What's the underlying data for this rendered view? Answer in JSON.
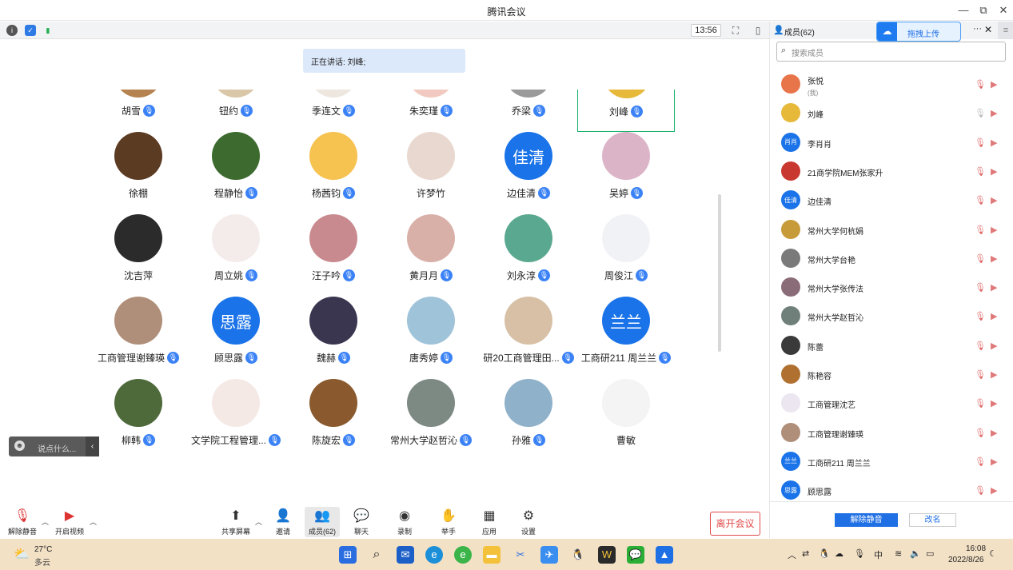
{
  "window": {
    "title": "腾讯会议",
    "minimize": "—",
    "restore": "⧉",
    "close": "✕"
  },
  "top": {
    "clock": "13:56",
    "info_icon": "info-icon",
    "shield_icon": "shield-icon",
    "signal_icon": "signal-icon"
  },
  "speaking": "正在讲话: 刘峰;",
  "participants": [
    {
      "name": "胡雪",
      "mic": true,
      "color": "#b5834f",
      "initials": ""
    },
    {
      "name": "钮约",
      "mic": true,
      "color": "#d9c7a8",
      "initials": ""
    },
    {
      "name": "季连文",
      "mic": true,
      "color": "#ede7df",
      "initials": ""
    },
    {
      "name": "朱奕瑾",
      "mic": true,
      "color": "#f1c9c0",
      "initials": ""
    },
    {
      "name": "乔梁",
      "mic": true,
      "color": "#9a9a9a",
      "initials": ""
    },
    {
      "name": "刘峰",
      "mic": true,
      "color": "#e6b93a",
      "initials": "",
      "selected": true
    },
    {
      "name": "徐棚",
      "mic": false,
      "color": "#5c3b23",
      "initials": ""
    },
    {
      "name": "程静怡",
      "mic": true,
      "color": "#3d6b2f",
      "initials": ""
    },
    {
      "name": "杨茜钧",
      "mic": true,
      "color": "#f6c250",
      "initials": ""
    },
    {
      "name": "许梦竹",
      "mic": false,
      "color": "#e9d8cf",
      "initials": ""
    },
    {
      "name": "边佳清",
      "mic": true,
      "color": "#1a73e8",
      "initials": "佳清"
    },
    {
      "name": "吴婷",
      "mic": true,
      "color": "#dcb4c8",
      "initials": ""
    },
    {
      "name": "沈吉萍",
      "mic": false,
      "color": "#2b2b2b",
      "initials": ""
    },
    {
      "name": "周立姚",
      "mic": true,
      "color": "#f4ecea",
      "initials": ""
    },
    {
      "name": "汪子吟",
      "mic": true,
      "color": "#c98a8f",
      "initials": ""
    },
    {
      "name": "黄月月",
      "mic": true,
      "color": "#d9b0a8",
      "initials": ""
    },
    {
      "name": "刘永淳",
      "mic": true,
      "color": "#5aa88f",
      "initials": ""
    },
    {
      "name": "周俊江",
      "mic": true,
      "color": "#f0f2f5",
      "initials": ""
    },
    {
      "name": "工商管理谢臻瑛",
      "mic": true,
      "color": "#b08f7a",
      "initials": ""
    },
    {
      "name": "顾思露",
      "mic": true,
      "color": "#1a73e8",
      "initials": "思露"
    },
    {
      "name": "魏赫",
      "mic": true,
      "color": "#3b3650",
      "initials": ""
    },
    {
      "name": "唐秀婷",
      "mic": true,
      "color": "#9fc3d8",
      "initials": ""
    },
    {
      "name": "研20工商管理田...",
      "mic": true,
      "color": "#d7c0a5",
      "initials": ""
    },
    {
      "name": "工商研211 周兰兰",
      "mic": true,
      "color": "#1a73e8",
      "initials": "兰兰"
    },
    {
      "name": "柳韩",
      "mic": true,
      "color": "#4e6a3a",
      "initials": ""
    },
    {
      "name": "文学院工程管理...",
      "mic": true,
      "color": "#f5e9e6",
      "initials": ""
    },
    {
      "name": "陈旋宏",
      "mic": true,
      "color": "#8a5a2e",
      "initials": ""
    },
    {
      "name": "常州大学赵哲沁",
      "mic": true,
      "color": "#7d8a84",
      "initials": ""
    },
    {
      "name": "孙雅",
      "mic": true,
      "color": "#8fb1c9",
      "initials": ""
    },
    {
      "name": "曹敏",
      "mic": false,
      "color": "#f4f4f4",
      "initials": ""
    }
  ],
  "chat": {
    "placeholder": "说点什么...",
    "emoji_icon": "emoji-icon"
  },
  "bottom": {
    "unmute": "解除静音",
    "video": "开启视频",
    "share": "共享屏幕",
    "invite": "邀请",
    "members": "成员(62)",
    "chat": "聊天",
    "record": "录制",
    "raise_hand": "举手",
    "apps": "应用",
    "settings": "设置",
    "leave": "离开会议"
  },
  "panel": {
    "title": "成员(62)",
    "upload": "拖拽上传",
    "search_placeholder": "搜索成员",
    "members": [
      {
        "name": "张悦",
        "sub": "(我)",
        "color": "#e8744a",
        "initials": ""
      },
      {
        "name": "刘峰",
        "sub": "",
        "color": "#e6b93a",
        "initials": ""
      },
      {
        "name": "李肖肖",
        "sub": "",
        "color": "#1a73e8",
        "initials": "肖肖"
      },
      {
        "name": "21商学院MEM张家升",
        "sub": "",
        "color": "#c9382e",
        "initials": ""
      },
      {
        "name": "边佳清",
        "sub": "",
        "color": "#1a73e8",
        "initials": "佳清"
      },
      {
        "name": "常州大学何杭娟",
        "sub": "",
        "color": "#c79a3a",
        "initials": ""
      },
      {
        "name": "常州大学台艳",
        "sub": "",
        "color": "#7a7a7a",
        "initials": ""
      },
      {
        "name": "常州大学张传法",
        "sub": "",
        "color": "#8a6b78",
        "initials": ""
      },
      {
        "name": "常州大学赵哲沁",
        "sub": "",
        "color": "#6f7f79",
        "initials": ""
      },
      {
        "name": "陈蕾",
        "sub": "",
        "color": "#3a3a3a",
        "initials": ""
      },
      {
        "name": "陈艳容",
        "sub": "",
        "color": "#b07030",
        "initials": ""
      },
      {
        "name": "工商管理沈艺",
        "sub": "",
        "color": "#ece6f0",
        "initials": ""
      },
      {
        "name": "工商管理谢臻瑛",
        "sub": "",
        "color": "#b08f7a",
        "initials": ""
      },
      {
        "name": "工商研211 周兰兰",
        "sub": "",
        "color": "#1a73e8",
        "initials": "兰兰"
      },
      {
        "name": "顾思露",
        "sub": "",
        "color": "#1a73e8",
        "initials": "思露"
      }
    ],
    "unmute_btn": "解除静音",
    "rename_btn": "改名"
  },
  "taskbar": {
    "weather": "27°C",
    "weather_desc": "多云",
    "time": "16:08",
    "date": "2022/8/26",
    "ime": "中"
  }
}
